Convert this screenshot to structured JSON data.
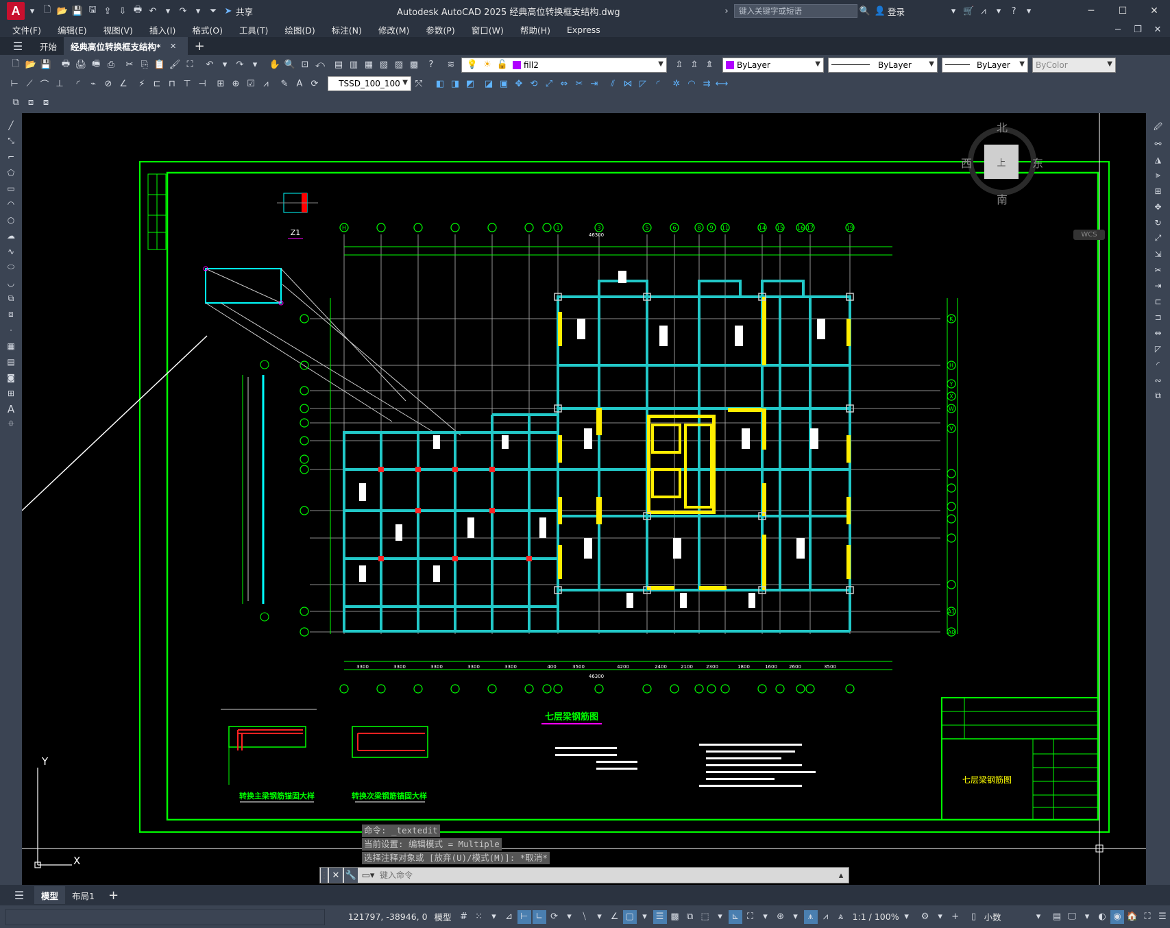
{
  "titlebar": {
    "app_icon": "A",
    "title": "Autodesk AutoCAD 2025    经典高位转换框支结构.dwg",
    "share_label": "共享",
    "search_placeholder": "键入关键字或短语",
    "signin_label": "登录"
  },
  "menu": [
    "文件(F)",
    "编辑(E)",
    "视图(V)",
    "插入(I)",
    "格式(O)",
    "工具(T)",
    "绘图(D)",
    "标注(N)",
    "修改(M)",
    "参数(P)",
    "窗口(W)",
    "帮助(H)",
    "Express"
  ],
  "tabs": {
    "start": "开始",
    "active": "经典高位转换框支结构*",
    "add": "+"
  },
  "toolbar": {
    "layer_combo": "fill2",
    "color_combo": "ByLayer",
    "linetype_combo": "ByLayer",
    "lineweight_combo": "ByLayer",
    "plotstyle_combo": "ByColor",
    "dimstyle_combo": "TSSD_100_100"
  },
  "viewcube": {
    "north": "北",
    "south": "南",
    "east": "东",
    "west": "西",
    "top": "上",
    "wcs": "WCS"
  },
  "drawing": {
    "main_title": "七层梁钢筋图",
    "detail1_title": "转换主梁钢筋锚固大样",
    "detail2_title": "转换次梁钢筋锚固大样",
    "titleblock_name": "七层梁钢筋图",
    "column_label": "Z1",
    "top_grid_labels": [
      "H",
      "H",
      "H",
      "H",
      "H",
      "H",
      "H",
      "1",
      "3",
      "5",
      "6",
      "8",
      "9",
      "11",
      "14",
      "15",
      "16",
      "17",
      "19"
    ],
    "bottom_dims": [
      "3300",
      "3300",
      "3300",
      "3300",
      "3300",
      "400",
      "3500",
      "4200",
      "2400",
      "2100",
      "2300",
      "1800",
      "1600",
      "2600",
      "3500"
    ],
    "total_dim": "46300",
    "right_grid_labels": [
      "K",
      "H",
      "Y",
      "X",
      "W",
      "V",
      "U",
      "T",
      "R",
      "P",
      "N",
      "M",
      "L",
      "F",
      "A",
      "A1",
      "A0"
    ]
  },
  "ucs": {
    "x": "X",
    "y": "Y"
  },
  "command": {
    "history": [
      "命令:  _textedit",
      "当前设置: 编辑模式 = Multiple",
      "选择注释对象或 [放弃(U)/模式(M)]: *取消*"
    ],
    "placeholder": "键入命令"
  },
  "layout_tabs": {
    "model": "模型",
    "layout1": "布局1",
    "add": "+"
  },
  "status": {
    "coords": "121797, -38946, 0",
    "model": "模型",
    "scale": "1:1 / 100%",
    "units": "小数"
  }
}
